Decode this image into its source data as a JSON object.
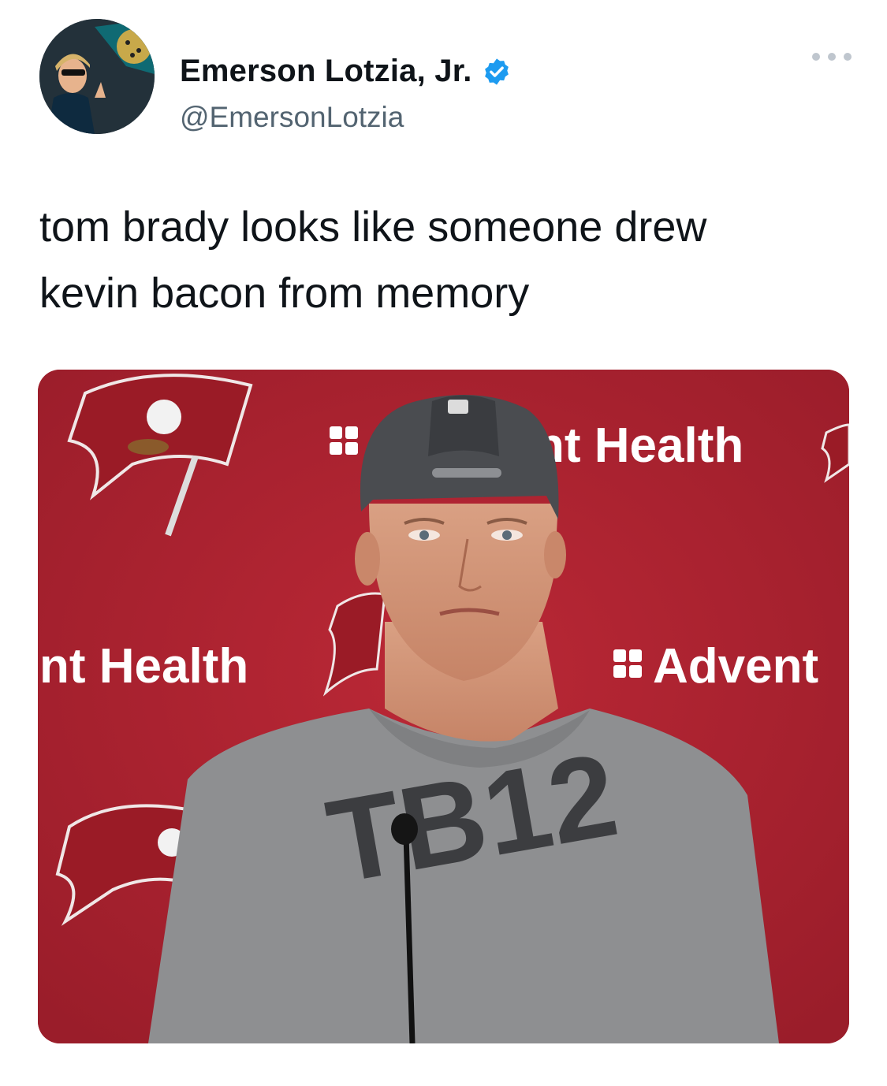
{
  "tweet": {
    "author": {
      "display_name": "Emerson Lotzia, Jr.",
      "handle": "@EmersonLotzia",
      "verified": true,
      "avatar_icon": "profile-photo"
    },
    "text_line_1": "tom brady looks like someone drew",
    "text_line_2": "kevin bacon from memory",
    "more_icon": "more-options-icon"
  },
  "media": {
    "backdrop_text_1": "nt Health",
    "backdrop_text_2": "nt Health",
    "backdrop_text_3": "Advent",
    "shirt_text": "TB12",
    "colors": {
      "backdrop_red": "#b02330",
      "shirt_gray": "#8e8f91",
      "cap_gray": "#4a4c50"
    }
  },
  "colors": {
    "verified_blue": "#1d9bf0",
    "secondary_text": "#536471"
  }
}
